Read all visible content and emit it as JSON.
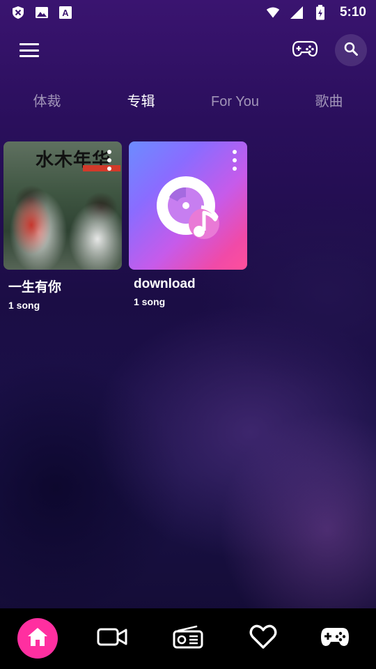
{
  "status_bar": {
    "time": "5:10",
    "left_icons": [
      "close-notification-icon",
      "image-icon",
      "font-a-icon"
    ],
    "right_icons": [
      "wifi-icon",
      "cellular-signal-icon",
      "battery-icon"
    ]
  },
  "top_bar": {
    "icons": [
      "menu-icon",
      "gamepad-icon",
      "search-icon"
    ]
  },
  "tabs": [
    {
      "label": "体裁",
      "active": false
    },
    {
      "label": "专辑",
      "active": true
    },
    {
      "label": "For You",
      "active": false
    },
    {
      "label": "歌曲",
      "active": false
    }
  ],
  "album_cover_text": "水木年华",
  "albums": [
    {
      "title": "一生有你",
      "subtitle": "1 song"
    },
    {
      "title": "download",
      "subtitle": "1 song"
    }
  ],
  "bottom_nav": [
    {
      "icon": "home-icon",
      "active": true
    },
    {
      "icon": "video-camera-icon",
      "active": false
    },
    {
      "icon": "radio-icon",
      "active": false
    },
    {
      "icon": "heart-icon",
      "active": false
    },
    {
      "icon": "gamepad-icon",
      "active": false
    }
  ],
  "colors": {
    "accent": "#ff2fa0",
    "nav_background": "#000000",
    "background_top": "#3a1470",
    "background_bottom": "#120a30"
  }
}
